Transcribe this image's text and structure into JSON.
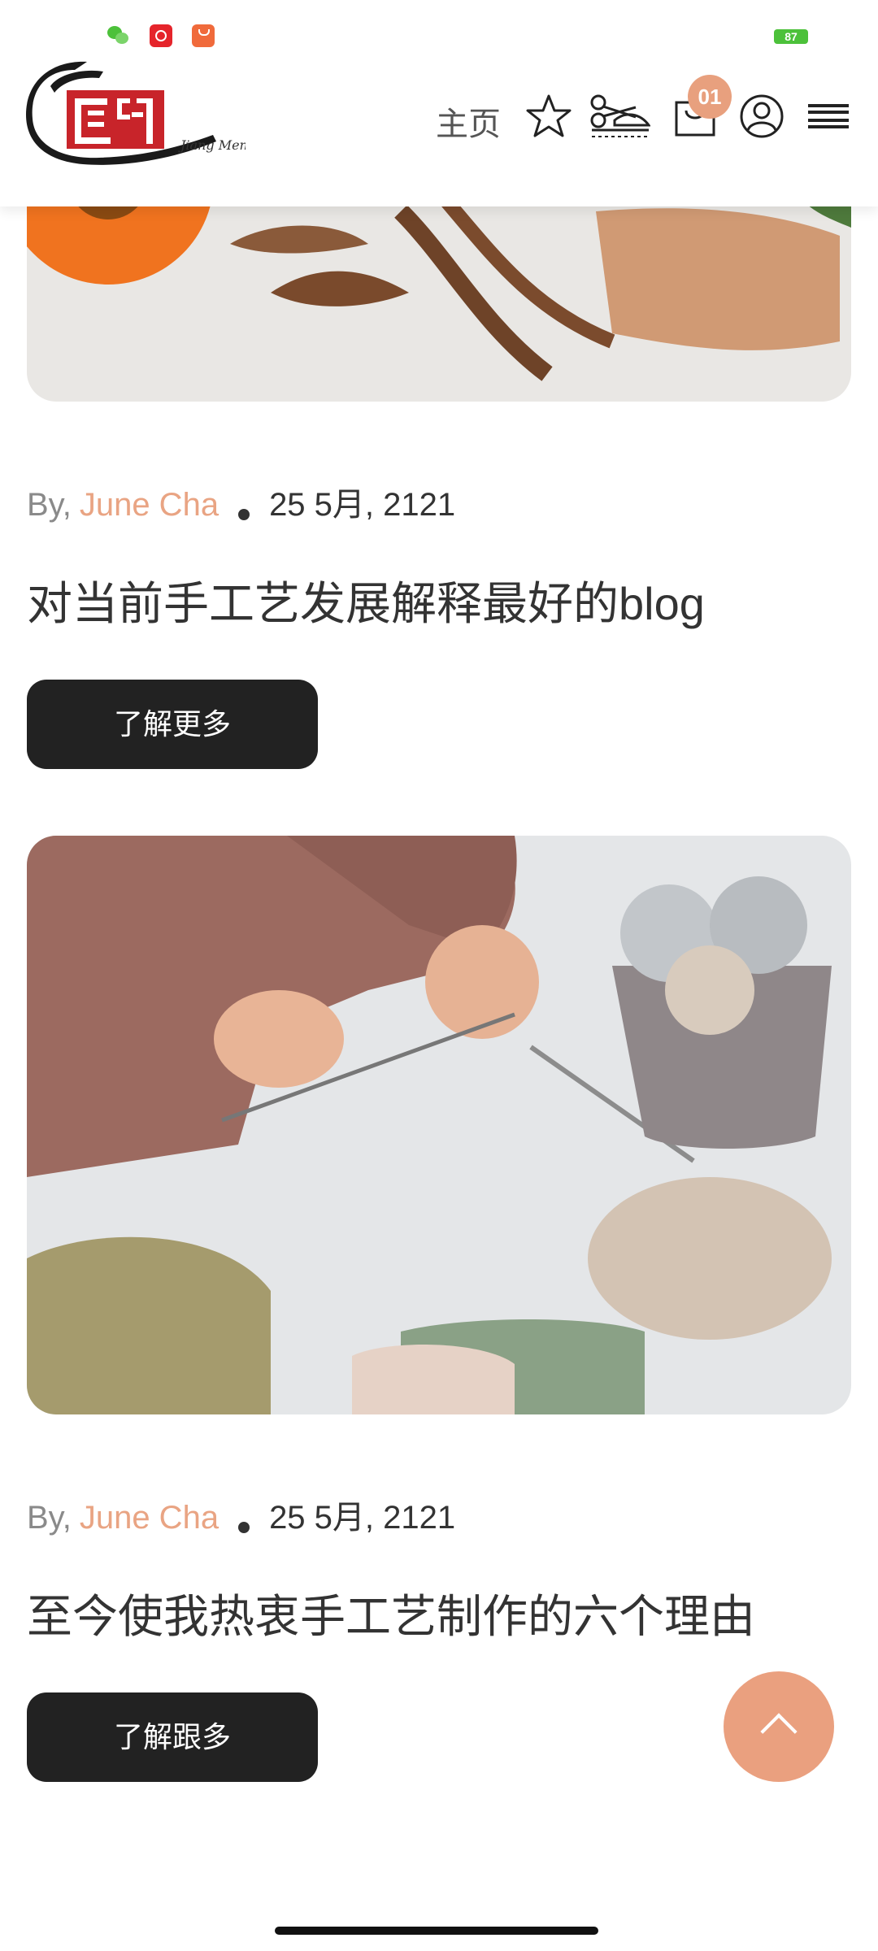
{
  "status_bar": {
    "battery": "87"
  },
  "header": {
    "home_label": "主页",
    "cart_count": "01"
  },
  "posts": [
    {
      "by": "By,",
      "author": "June Cha",
      "date": "25 5月, 2121",
      "title": "对当前手工艺发展解释最好的blog",
      "button": "了解更多"
    },
    {
      "by": "By,",
      "author": "June Cha",
      "date": "25 5月, 2121",
      "title": "至今使我热衷手工艺制作的六个理由",
      "button": "了解跟多"
    }
  ],
  "colors": {
    "accent": "#e9a483",
    "button_bg": "#222222"
  }
}
